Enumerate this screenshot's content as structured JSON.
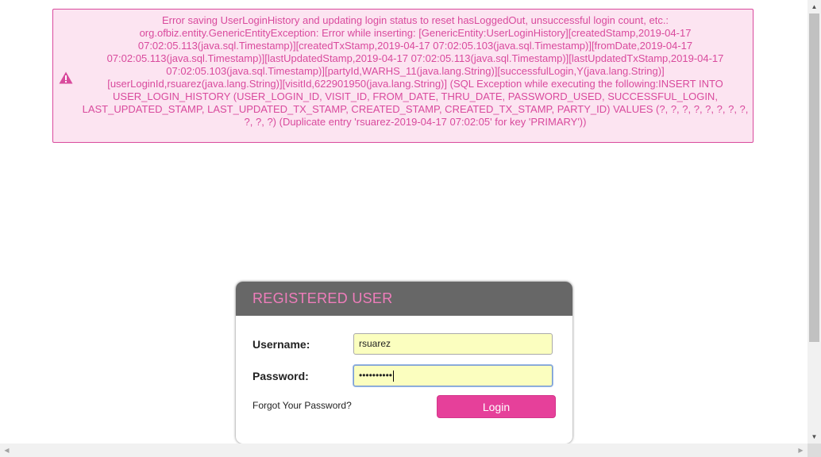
{
  "error": {
    "icon": "warning-triangle-icon",
    "message": "Error saving UserLoginHistory and updating login status to reset hasLoggedOut, unsuccessful login count, etc.: org.ofbiz.entity.GenericEntityException: Error while inserting: [GenericEntity:UserLoginHistory][createdStamp,2019-04-17 07:02:05.113(java.sql.Timestamp)][createdTxStamp,2019-04-17 07:02:05.103(java.sql.Timestamp)][fromDate,2019-04-17 07:02:05.113(java.sql.Timestamp)][lastUpdatedStamp,2019-04-17 07:02:05.113(java.sql.Timestamp)][lastUpdatedTxStamp,2019-04-17 07:02:05.103(java.sql.Timestamp)][partyId,WARHS_11(java.lang.String)][successfulLogin,Y(java.lang.String)][userLoginId,rsuarez(java.lang.String)][visitId,622901950(java.lang.String)] (SQL Exception while executing the following:INSERT INTO USER_LOGIN_HISTORY (USER_LOGIN_ID, VISIT_ID, FROM_DATE, THRU_DATE, PASSWORD_USED, SUCCESSFUL_LOGIN, LAST_UPDATED_STAMP, LAST_UPDATED_TX_STAMP, CREATED_STAMP, CREATED_TX_STAMP, PARTY_ID) VALUES (?, ?, ?, ?, ?, ?, ?, ?, ?, ?, ?) (Duplicate entry 'rsuarez-2019-04-17 07:02:05' for key 'PRIMARY'))"
  },
  "login": {
    "title": "REGISTERED USER",
    "username_label": "Username:",
    "username_value": "rsuarez",
    "password_label": "Password:",
    "password_value": "••••••••••",
    "forgot_label": "Forgot Your Password?",
    "login_button_label": "Login"
  },
  "colors": {
    "accent": "#e6409a",
    "title_pink": "#ef7dbb",
    "error_text": "#d94a9d",
    "error_bg": "#fce4f1",
    "header_bg": "#676767",
    "input_bg": "#fbfebf"
  }
}
